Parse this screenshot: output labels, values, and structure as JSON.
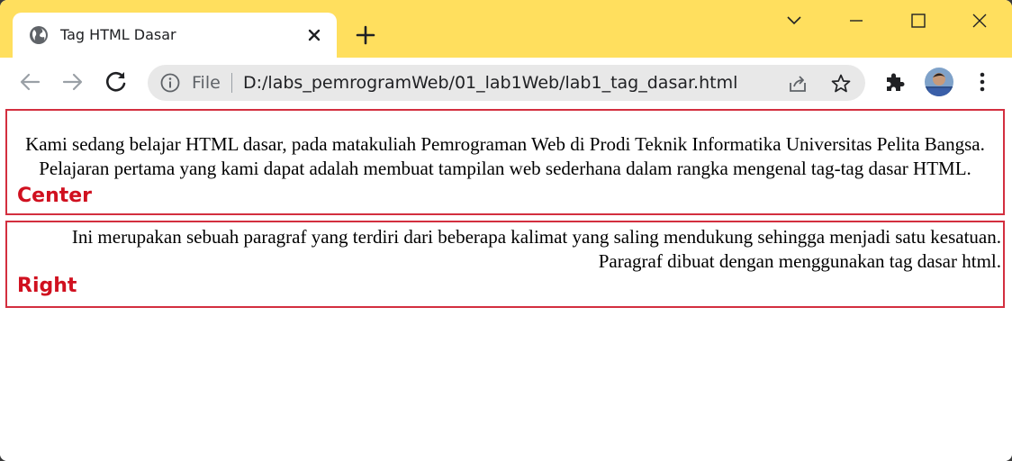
{
  "browser": {
    "tab": {
      "title": "Tag HTML Dasar",
      "favicon": "globe-icon"
    },
    "address_bar": {
      "scheme_label": "File",
      "url": "D:/labs_pemrogramWeb/01_lab1Web/lab1_tag_dasar.html"
    },
    "colors": {
      "tab_strip": "#ffdf5e",
      "omnibox": "#e8e8e8"
    }
  },
  "page": {
    "paragraph_center": "Kami sedang belajar HTML dasar, pada matakuliah Pemrograman Web di Prodi Teknik Informatika Universitas Pelita Bangsa. Pelajaran pertama yang kami dapat adalah membuat tampilan web sederhana dalam rangka mengenal tag-tag dasar HTML.",
    "paragraph_right": "Ini merupakan sebuah paragraf yang terdiri dari beberapa kalimat yang saling mendukung sehingga menjadi satu kesatuan. Paragraf dibuat dengan menggunakan tag dasar html.",
    "annotations": {
      "center_label": "Center",
      "right_label": "Right",
      "color": "#d0101f"
    }
  }
}
